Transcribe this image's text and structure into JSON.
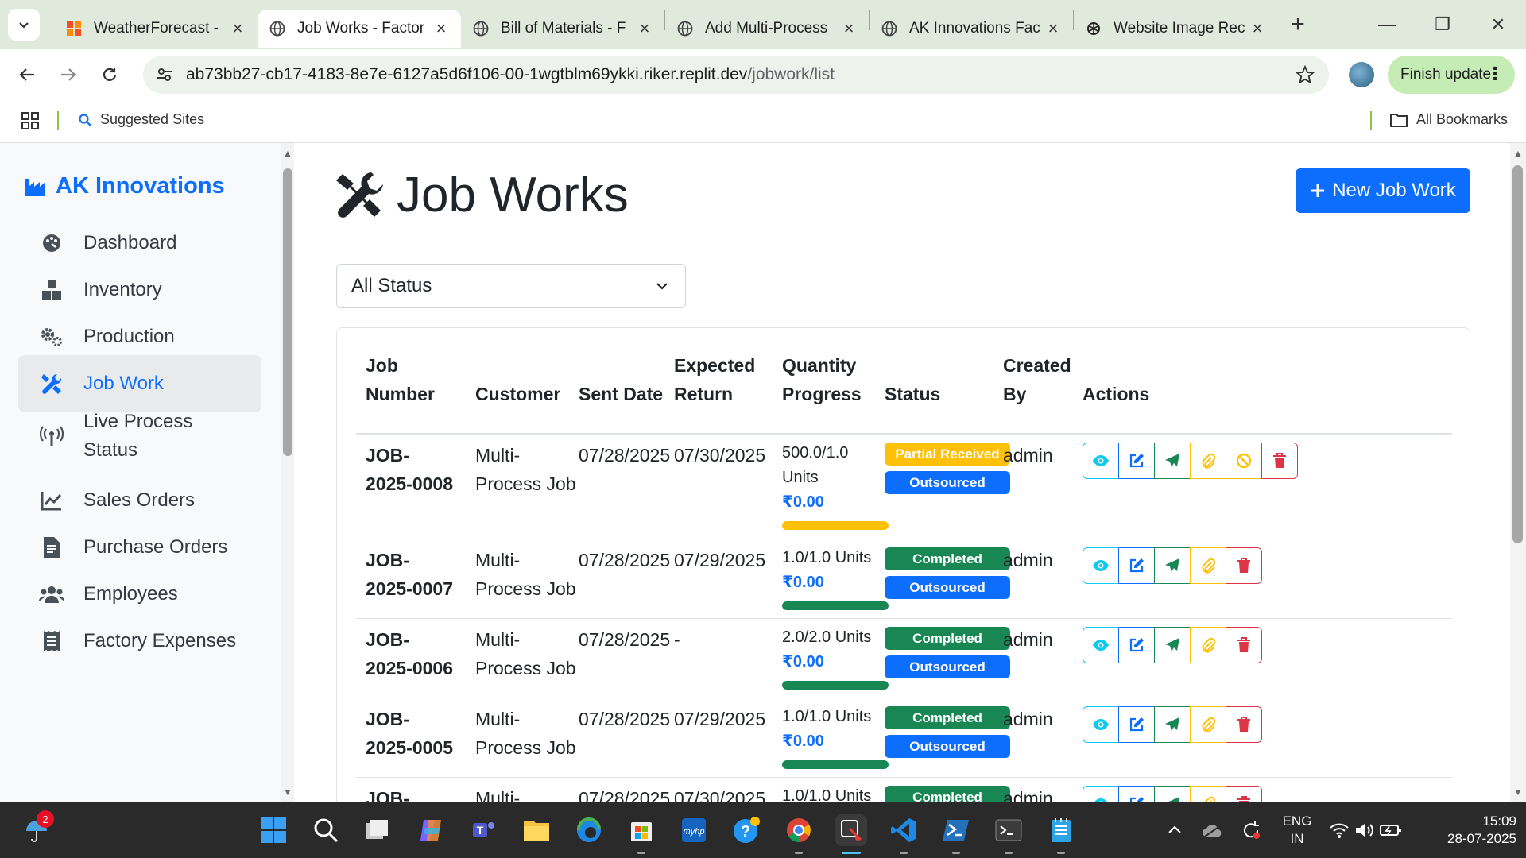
{
  "browser": {
    "tabs": [
      {
        "title": "WeatherForecast -",
        "active": false
      },
      {
        "title": "Job Works - Factor",
        "active": true
      },
      {
        "title": "Bill of Materials - F",
        "active": false
      },
      {
        "title": "Add Multi-Process",
        "active": false
      },
      {
        "title": "AK Innovations Fac",
        "active": false
      },
      {
        "title": "Website Image Rec",
        "active": false
      }
    ],
    "url_host": "ab73bb27-cb17-4183-8e7e-6127a5d6f106-00-1wgtblm69ykki.riker.replit.dev",
    "url_path": "/jobwork/list",
    "finish_update": "Finish update",
    "bookmark_suggested": "Suggested Sites",
    "bookmark_all": "All Bookmarks"
  },
  "sidebar": {
    "brand": "AK Innovations",
    "items": [
      {
        "label": "Dashboard",
        "icon": "palette-icon",
        "active": false
      },
      {
        "label": "Inventory",
        "icon": "boxes-icon",
        "active": false
      },
      {
        "label": "Production",
        "icon": "cogs-icon",
        "active": false
      },
      {
        "label": "Job Work",
        "icon": "tools-icon",
        "active": true
      },
      {
        "label": "Live Process Status",
        "icon": "broadcast-icon",
        "active": false
      },
      {
        "label": "Sales Orders",
        "icon": "chart-line-icon",
        "active": false
      },
      {
        "label": "Purchase Orders",
        "icon": "file-invoice-icon",
        "active": false
      },
      {
        "label": "Employees",
        "icon": "users-icon",
        "active": false
      },
      {
        "label": "Factory Expenses",
        "icon": "receipt-icon",
        "active": false
      }
    ]
  },
  "main": {
    "title": "Job Works",
    "new_button": "New Job Work",
    "status_filter": "All Status",
    "columns": [
      "Job Number",
      "Customer",
      "Sent Date",
      "Expected Return",
      "Quantity Progress",
      "Status",
      "Created By",
      "Actions"
    ],
    "rows": [
      {
        "job": "JOB-2025-0008",
        "customer": "Multi-Process Job",
        "sent": "07/28/2025",
        "expected": "07/30/2025",
        "qty": "500.0/1.0 Units",
        "amount": "₹0.00",
        "progress": 100,
        "progress_color": "#ffc107",
        "status": "Partial Received",
        "status_kind": "warn",
        "type": "Outsourced",
        "created_by": "admin",
        "has_cancel": true
      },
      {
        "job": "JOB-2025-0007",
        "customer": "Multi-Process Job",
        "sent": "07/28/2025",
        "expected": "07/29/2025",
        "qty": "1.0/1.0 Units",
        "amount": "₹0.00",
        "progress": 100,
        "progress_color": "#198754",
        "status": "Completed",
        "status_kind": "succ",
        "type": "Outsourced",
        "created_by": "admin",
        "has_cancel": false
      },
      {
        "job": "JOB-2025-0006",
        "customer": "Multi-Process Job",
        "sent": "07/28/2025",
        "expected": "-",
        "qty": "2.0/2.0 Units",
        "amount": "₹0.00",
        "progress": 100,
        "progress_color": "#198754",
        "status": "Completed",
        "status_kind": "succ",
        "type": "Outsourced",
        "created_by": "admin",
        "has_cancel": false
      },
      {
        "job": "JOB-2025-0005",
        "customer": "Multi-Process Job",
        "sent": "07/28/2025",
        "expected": "07/29/2025",
        "qty": "1.0/1.0 Units",
        "amount": "₹0.00",
        "progress": 100,
        "progress_color": "#198754",
        "status": "Completed",
        "status_kind": "succ",
        "type": "Outsourced",
        "created_by": "admin",
        "has_cancel": false
      },
      {
        "job": "JOB-2025-",
        "customer": "Multi-",
        "sent": "07/28/2025",
        "expected": "07/30/2025",
        "qty": "1.0/1.0 Units",
        "amount": "",
        "progress": 0,
        "progress_color": "#198754",
        "status": "Completed",
        "status_kind": "succ",
        "type": "",
        "created_by": "admin",
        "has_cancel": false
      }
    ]
  },
  "taskbar": {
    "notification_count": "2",
    "lang_top": "ENG",
    "lang_bottom": "IN",
    "time": "15:09",
    "date": "28-07-2025"
  },
  "colors": {
    "primary": "#0d6efd",
    "success": "#198754",
    "warning": "#ffc107",
    "info": "#0dcaf0",
    "danger": "#dc3545"
  }
}
